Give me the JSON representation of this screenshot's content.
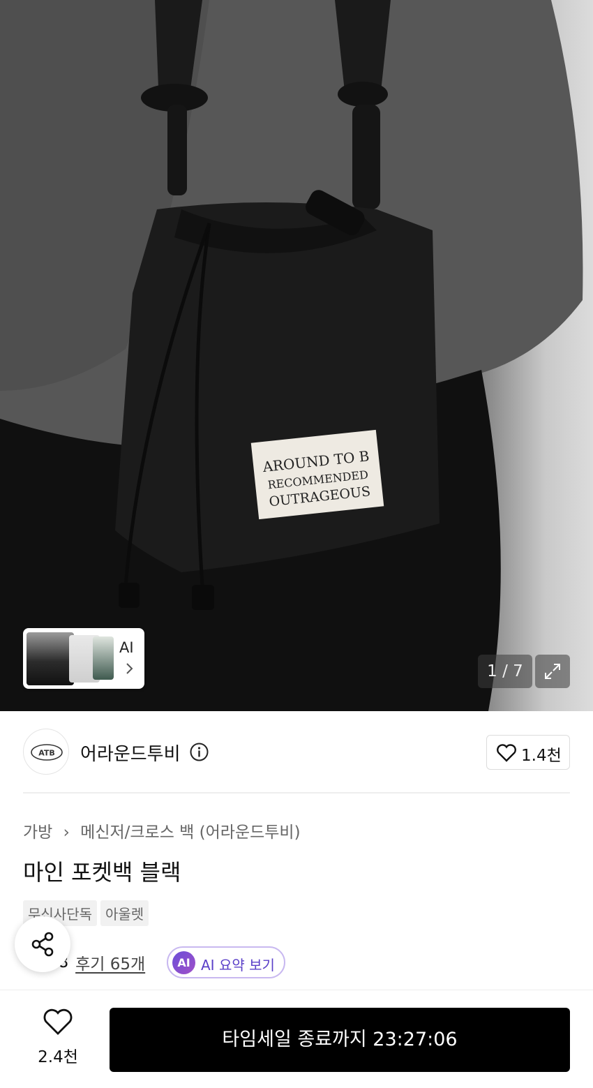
{
  "gallery": {
    "patch_text": [
      "AROUND TO B",
      "RECOMMENDED",
      "OUTRAGEOUS"
    ],
    "ai_thumb_label": "AI",
    "counter": "1 / 7",
    "expand_icon": "expand-icon"
  },
  "brand": {
    "logo_text": "ATB",
    "name": "어라운드투비",
    "info_icon": "info-icon",
    "like_count": "1.4천"
  },
  "product": {
    "breadcrumb": [
      "가방",
      "메신저/크로스 백 (어라운드투비)"
    ],
    "title": "마인 포켓백 블랙",
    "tags": [
      "무신사단독",
      "아울렛"
    ],
    "rating": "4.8",
    "reviews": "후기 65개",
    "ai_badge": "AI",
    "ai_summary": "AI 요약 보기"
  },
  "bottom": {
    "wish_count": "2.4천",
    "buy_label": "타임세일 종료까지 23:27:06"
  },
  "colors": {
    "accent": "#5a3fc8",
    "star": "#f5c518",
    "buy_bg": "#000000"
  }
}
